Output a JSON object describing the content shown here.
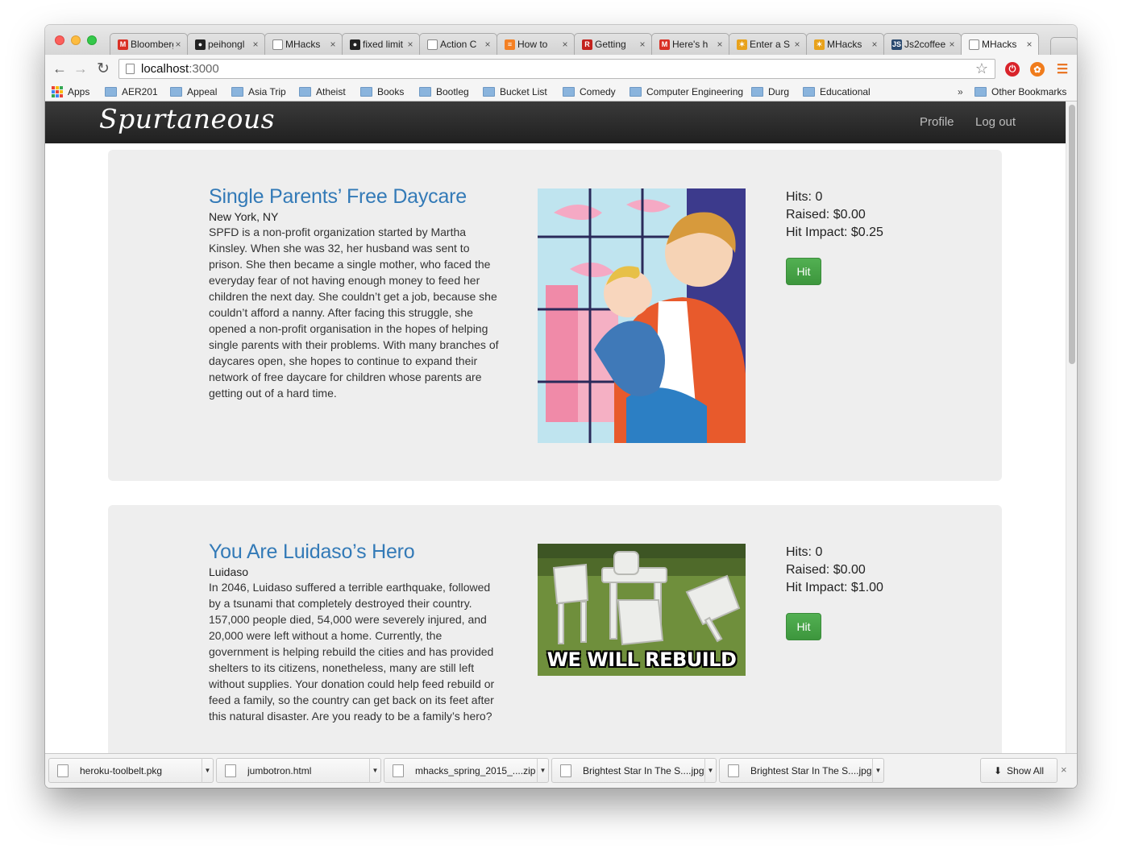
{
  "browser": {
    "tabs": [
      {
        "title": "Bloomberg",
        "icon": "gmail-icon",
        "color": "#d93025",
        "glyph": "M"
      },
      {
        "title": "peihongl",
        "icon": "github-icon",
        "color": "#222222",
        "glyph": "●"
      },
      {
        "title": "MHacks",
        "icon": "page-icon",
        "color": "#ffffff",
        "glyph": ""
      },
      {
        "title": "fixed limit",
        "icon": "github-icon",
        "color": "#222222",
        "glyph": "●"
      },
      {
        "title": "Action C",
        "icon": "page-icon",
        "color": "#ffffff",
        "glyph": ""
      },
      {
        "title": "How to",
        "icon": "stackoverflow-icon",
        "color": "#f48024",
        "glyph": "≡"
      },
      {
        "title": "Getting",
        "icon": "rails-icon",
        "color": "#c3221d",
        "glyph": "R"
      },
      {
        "title": "Here's h",
        "icon": "gmail-icon",
        "color": "#d93025",
        "glyph": "M"
      },
      {
        "title": "Enter a S",
        "icon": "mhacks-icon",
        "color": "#e8a21b",
        "glyph": "✶"
      },
      {
        "title": "MHacks",
        "icon": "mhacks-icon",
        "color": "#e8a21b",
        "glyph": "✶"
      },
      {
        "title": "Js2coffee",
        "icon": "js2coffee-icon",
        "color": "#2b4a6f",
        "glyph": "JS"
      },
      {
        "title": "MHacks",
        "icon": "page-icon",
        "color": "#ffffff",
        "glyph": "",
        "active": true
      }
    ],
    "close_glyph": "×",
    "url_host": "localhost",
    "url_port": ":3000",
    "bookmarks": [
      "Apps",
      "AER201",
      "Appeal",
      "Asia Trip",
      "Atheist",
      "Books",
      "Bootleg",
      "Bucket List",
      "Comedy",
      "Computer Engineering",
      "Durg",
      "Educational"
    ],
    "bookmarks_overflow": "»",
    "other_bookmarks": "Other Bookmarks"
  },
  "app": {
    "brand": "Spurtaneous",
    "nav": {
      "profile": "Profile",
      "logout": "Log out"
    }
  },
  "campaigns": [
    {
      "title": "Single Parents’ Free Daycare",
      "location": "New York, NY",
      "description": "SPFD is a non-profit organization started by Martha Kinsley. When she was 32, her husband was sent to prison. She then became a single mother, who faced the everyday fear of not having enough money to feed her children the next day. She couldn’t get a job, because she couldn’t afford a nanny. After facing this struggle, she opened a non-profit organisation in the hopes of helping single parents with their problems. With many branches of daycares open, she hopes to continue to expand their network of free daycare for children whose parents are getting out of a hard time.",
      "hits": "Hits: 0",
      "raised": "Raised: $0.00",
      "impact": "Hit Impact: $0.25",
      "button": "Hit"
    },
    {
      "title": "You Are Luidaso’s Hero",
      "location": "Luidaso",
      "description": "In 2046, Luidaso suffered a terrible earthquake, followed by a tsunami that completely destroyed their country. 157,000 people died, 54,000 were severely injured, and 20,000 were left without a home. Currently, the government is helping rebuild the cities and has provided shelters to its citizens, nonetheless, many are still left without supplies. Your donation could help feed rebuild or feed a family, so the country can get back on its feet after this natural disaster. Are you ready to be a family’s hero?",
      "image_caption": "WE WILL REBUILD",
      "hits": "Hits: 0",
      "raised": "Raised: $0.00",
      "impact": "Hit Impact: $1.00",
      "button": "Hit"
    }
  ],
  "downloads": {
    "items": [
      "heroku-toolbelt.pkg",
      "jumbotron.html",
      "mhacks_spring_2015_....zip",
      "Brightest Star In The S....jpg",
      "Brightest Star In The S....jpg"
    ],
    "show_all": "Show All",
    "close_glyph": "×"
  }
}
